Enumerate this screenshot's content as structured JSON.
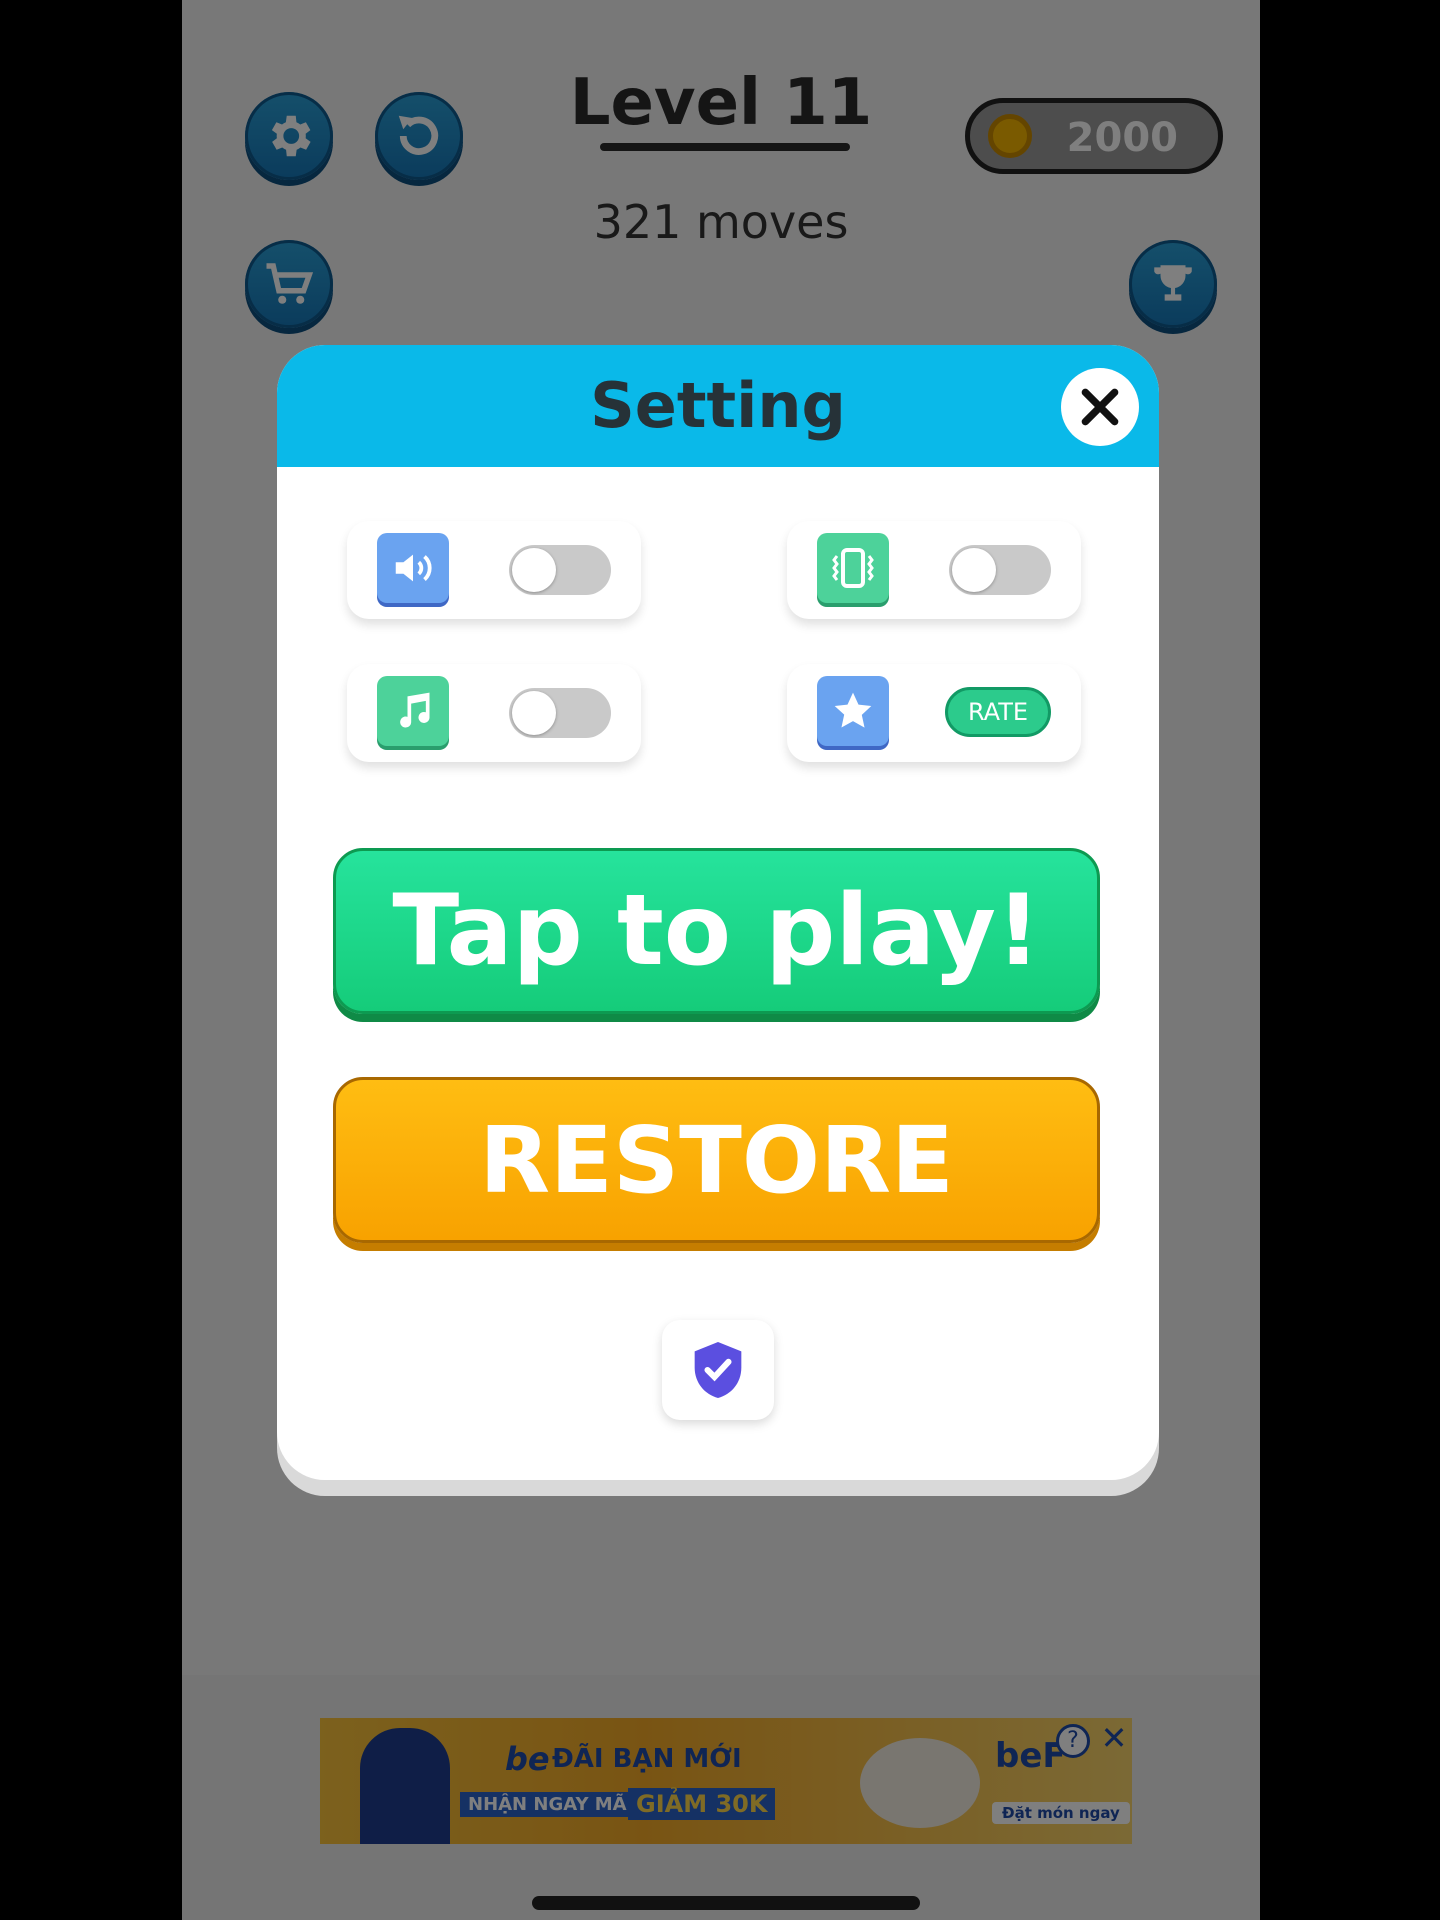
{
  "header": {
    "level_title": "Level 11",
    "moves": "321 moves",
    "coins": "2000"
  },
  "dialog": {
    "title": "Setting",
    "toggles": [
      {
        "name": "sound",
        "icon": "speaker-icon",
        "on": false
      },
      {
        "name": "vibration",
        "icon": "vibrate-phone-icon",
        "on": false
      },
      {
        "name": "music",
        "icon": "music-note-icon",
        "on": false
      }
    ],
    "rate_label": "RATE",
    "play_label": "Tap to play!",
    "restore_label": "RESTORE"
  },
  "ad": {
    "brand": "be",
    "headline": "ĐÃI BẠN MỚI",
    "subline_1": "NHẬN NGAY MÃ",
    "subline_2": "GIẢM 30K",
    "cta": "Đặt món ngay",
    "brand_right": "beF"
  },
  "colors": {
    "header_blue": "#0ab9e9",
    "play_green": "#1fd98a",
    "restore_orange": "#fbae0a",
    "sound_tile": "#6aa3f0",
    "music_tile": "#4dd29a",
    "shield": "#5b4fe0"
  }
}
